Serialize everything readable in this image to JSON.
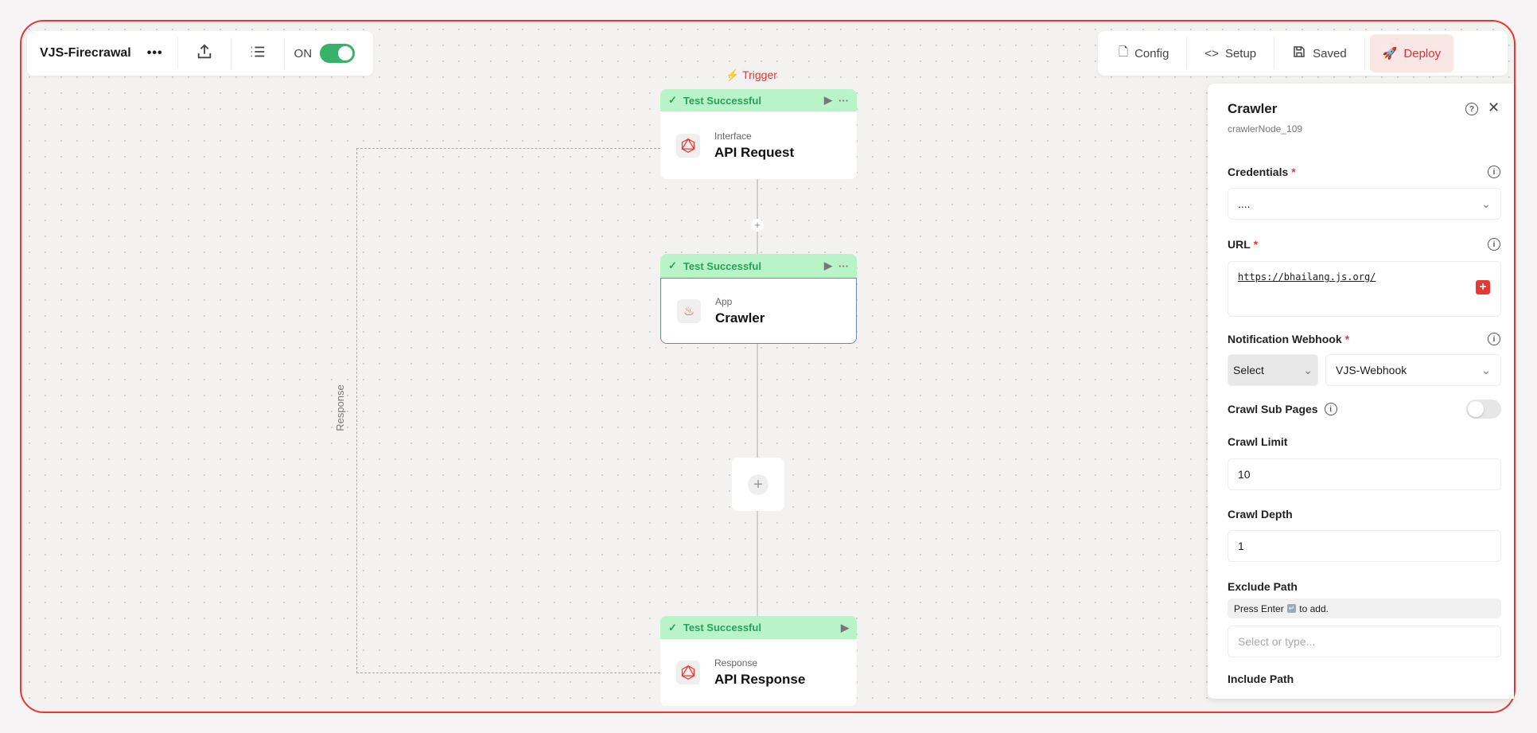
{
  "toolbar_left": {
    "title": "VJS-Firecrawal",
    "toggle_label": "ON",
    "toggle_on": true
  },
  "toolbar_right": {
    "config": "Config",
    "setup": "Setup",
    "saved": "Saved",
    "deploy": "Deploy"
  },
  "colors": {
    "accent": "#e53935",
    "success": "#27a259",
    "success_bg": "#b9f3c8",
    "toggle": "#38b26a"
  },
  "canvas": {
    "trigger_label": "Trigger",
    "loop_label": "Response",
    "nodes": [
      {
        "status": "Test Successful",
        "type": "Interface",
        "name": "API Request",
        "icon": "graphql-icon"
      },
      {
        "status": "Test Successful",
        "type": "App",
        "name": "Crawler",
        "icon": "flame-icon"
      },
      {
        "status": "Test Successful",
        "type": "Response",
        "name": "API Response",
        "icon": "graphql-icon"
      }
    ]
  },
  "panel": {
    "title": "Crawler",
    "node_id": "crawlerNode_109",
    "credentials_label": "Credentials",
    "credentials_value": "....",
    "url_label": "URL",
    "url_value": "https://bhailang.js.org/",
    "webhook_label": "Notification Webhook",
    "webhook_mode": "Select",
    "webhook_value": "VJS-Webhook",
    "crawl_sub_label": "Crawl Sub Pages",
    "crawl_sub_on": false,
    "crawl_limit_label": "Crawl Limit",
    "crawl_limit_value": "10",
    "crawl_depth_label": "Crawl Depth",
    "crawl_depth_value": "1",
    "exclude_label": "Exclude Path",
    "exclude_hint_pre": "Press Enter",
    "exclude_hint_post": "to add.",
    "exclude_placeholder": "Select or type...",
    "include_label": "Include Path",
    "required_mark": "*"
  }
}
